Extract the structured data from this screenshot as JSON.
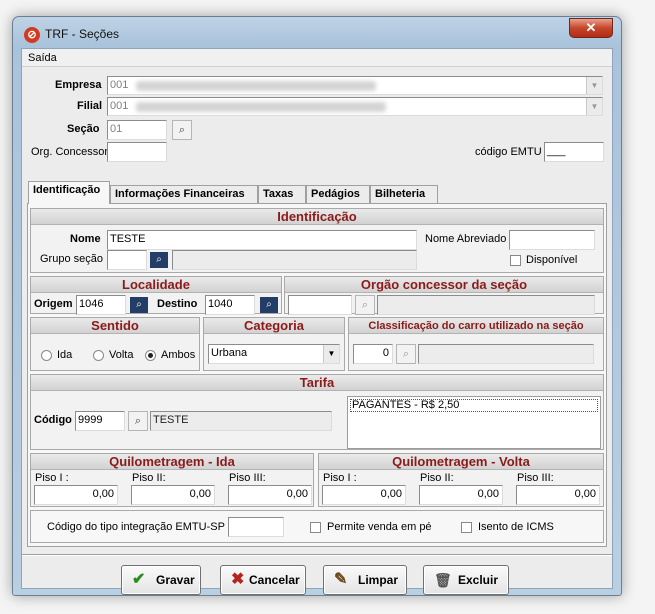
{
  "window": {
    "title": "TRF - Seções",
    "close_glyph": "✕",
    "app_icon_glyph": "⊘"
  },
  "menu": {
    "items": [
      "Saída"
    ]
  },
  "header": {
    "empresa_label": "Empresa",
    "empresa_value": "001",
    "filial_label": "Filial",
    "filial_value": "001",
    "secao_label": "Seção",
    "secao_value": "01",
    "org_concessor_label": "Org. Concessor",
    "org_concessor_value": "",
    "codigo_emtu_label": "código EMTU",
    "codigo_emtu_value": "___"
  },
  "tabs": [
    "Identificação",
    "Informações Financeiras",
    "Taxas",
    "Pedágios",
    "Bilheteria"
  ],
  "identificacao": {
    "title": "Identificação",
    "nome_label": "Nome",
    "nome_value": "TESTE",
    "nome_abreviado_label": "Nome Abreviado",
    "nome_abreviado_value": "",
    "grupo_secao_label": "Grupo seção",
    "grupo_secao_value": "",
    "grupo_secao_desc": "",
    "disponivel_label": "Disponível",
    "disponivel_checked": false
  },
  "localidade": {
    "title": "Localidade",
    "origem_label": "Origem",
    "origem_value": "1046",
    "destino_label": "Destino",
    "destino_value": "1040"
  },
  "orgao": {
    "title": "Orgão concessor da seção",
    "code": "",
    "desc": ""
  },
  "sentido": {
    "title": "Sentido",
    "options": [
      "Ida",
      "Volta",
      "Ambos"
    ],
    "selected": "Ambos"
  },
  "categoria": {
    "title": "Categoria",
    "selected": "Urbana"
  },
  "classificacao": {
    "title": "Classificação do carro utilizado na seção",
    "value": "0",
    "desc": ""
  },
  "tarifa": {
    "title": "Tarifa",
    "codigo_label": "Código",
    "codigo_value": "9999",
    "codigo_desc": "TESTE",
    "list_items": [
      "PAGANTES - R$ 2,50"
    ]
  },
  "km_ida": {
    "title": "Quilometragem - Ida",
    "piso1_label": "Piso I :",
    "piso2_label": "Piso II:",
    "piso3_label": "Piso III:",
    "piso1": "0,00",
    "piso2": "0,00",
    "piso3": "0,00"
  },
  "km_volta": {
    "title": "Quilometragem - Volta",
    "piso1_label": "Piso I :",
    "piso2_label": "Piso II:",
    "piso3_label": "Piso III:",
    "piso1": "0,00",
    "piso2": "0,00",
    "piso3": "0,00"
  },
  "bottom": {
    "integracao_label": "Código do tipo integração EMTU-SP",
    "integracao_value": "",
    "permite_venda_label": "Permite venda em pé",
    "isento_icms_label": "Isento de ICMS"
  },
  "buttons": {
    "gravar": "Gravar",
    "cancelar": "Cancelar",
    "limpar": "Limpar",
    "excluir": "Excluir"
  },
  "icons": {
    "check": "✔",
    "x": "✖",
    "broom": "✎",
    "trash": "🗑",
    "binoculars": "⌕"
  },
  "colors": {
    "section_title": "#8b1a1a",
    "gravar_icon": "#2a8c1d",
    "cancelar_icon": "#b3261e"
  }
}
